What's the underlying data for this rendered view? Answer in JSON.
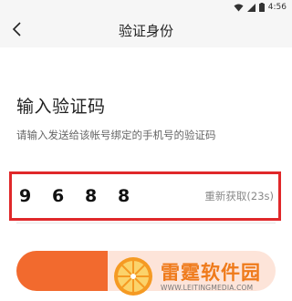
{
  "status_bar": {
    "time": "4:56",
    "icons": [
      "wifi-icon",
      "signal-icon",
      "battery-icon"
    ]
  },
  "nav": {
    "title": "验证身份",
    "back_icon": "back-chevron-icon"
  },
  "main": {
    "heading": "输入验证码",
    "hint": "请输入发送给该帐号绑定的手机号的验证码"
  },
  "code_input": {
    "digits": [
      "9",
      "6",
      "8",
      "8"
    ],
    "resend_label": "重新获取(23s)"
  },
  "watermark": {
    "name": "雷霆软件园",
    "url": "WWW.LEITINGMEDIA.COM"
  },
  "colors": {
    "accent": "#f26a2e",
    "highlight_border": "#e0282a",
    "watermark_text": "#ef7a1a"
  }
}
